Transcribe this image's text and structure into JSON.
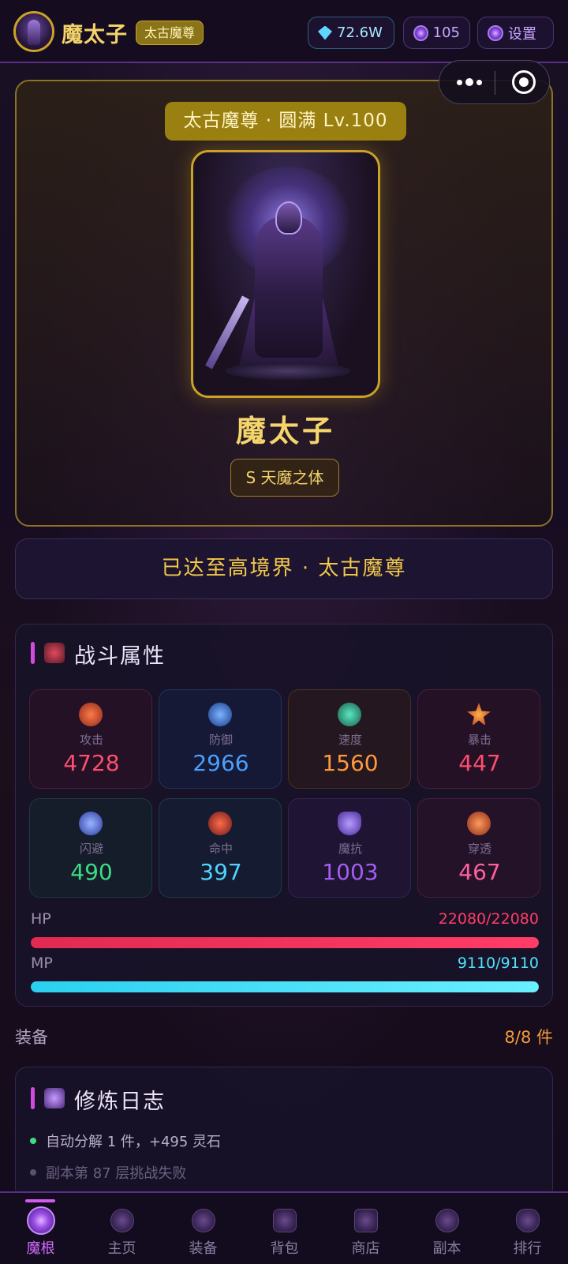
{
  "header": {
    "player_name": "魔太子",
    "realm_badge": "太古魔尊",
    "gems": "72.6W",
    "orbs": "105",
    "settings_label": "设置"
  },
  "hero": {
    "title": "太古魔尊 · 圆满 Lv.100",
    "name": "魔太子",
    "talent": "S 天魔之体"
  },
  "realm_banner": "已达至高境界 · 太古魔尊",
  "stats": {
    "section_title": "战斗属性",
    "items": [
      {
        "label": "攻击",
        "value": "4728",
        "color": "#ff4d6d"
      },
      {
        "label": "防御",
        "value": "2966",
        "color": "#4aa0ff"
      },
      {
        "label": "速度",
        "value": "1560",
        "color": "#ff9a3c"
      },
      {
        "label": "暴击",
        "value": "447",
        "color": "#ff4d6d"
      },
      {
        "label": "闪避",
        "value": "490",
        "color": "#3ddc84"
      },
      {
        "label": "命中",
        "value": "397",
        "color": "#4fd3ff"
      },
      {
        "label": "魔抗",
        "value": "1003",
        "color": "#a35df0"
      },
      {
        "label": "穿透",
        "value": "467",
        "color": "#ff5fa0"
      }
    ],
    "hp_label": "HP",
    "hp_value": "22080/22080",
    "hp_fill": 1.0,
    "mp_label": "MP",
    "mp_value": "9110/9110",
    "mp_fill": 1.0
  },
  "equipment": {
    "label": "装备",
    "count": "8/8 件"
  },
  "log": {
    "section_title": "修炼日志",
    "entries": [
      "自动分解 1 件，+495 灵石",
      "副本第 87 层挑战失败"
    ]
  },
  "nav": [
    {
      "label": "魔根",
      "icon": "demon-root-icon"
    },
    {
      "label": "主页",
      "icon": "home-icon"
    },
    {
      "label": "装备",
      "icon": "equipment-icon"
    },
    {
      "label": "背包",
      "icon": "bag-icon"
    },
    {
      "label": "商店",
      "icon": "shop-icon"
    },
    {
      "label": "副本",
      "icon": "dungeon-icon"
    },
    {
      "label": "排行",
      "icon": "ranking-icon"
    }
  ],
  "colors": {
    "gold": "#f3d36a",
    "accent_purple": "#d24be0",
    "hp_bar": "#ff3d66",
    "mp_bar": "#4fe3ff",
    "equip_count": "#f59a3a"
  }
}
